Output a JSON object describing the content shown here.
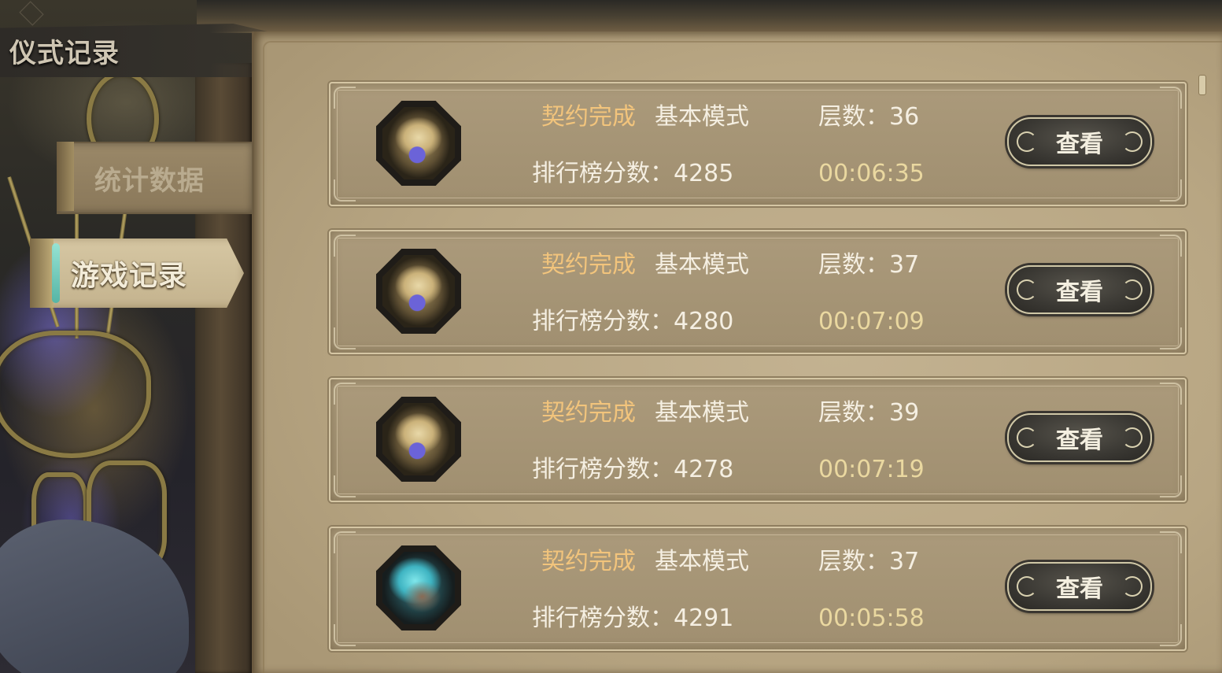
{
  "header": {
    "title": "仪式记录"
  },
  "sidebar": {
    "tabs": [
      {
        "label": "统计数据",
        "active": false
      },
      {
        "label": "游戏记录",
        "active": true
      }
    ]
  },
  "records": [
    {
      "avatar": "blonde-hero-portrait",
      "status": "契约完成",
      "mode": "基本模式",
      "floor": "层数：36",
      "score": "排行榜分数：4285",
      "time": "00:06:35",
      "button": "查看"
    },
    {
      "avatar": "blonde-hero-portrait",
      "status": "契约完成",
      "mode": "基本模式",
      "floor": "层数：37",
      "score": "排行榜分数：4280",
      "time": "00:07:09",
      "button": "查看"
    },
    {
      "avatar": "blonde-hero-portrait",
      "status": "契约完成",
      "mode": "基本模式",
      "floor": "层数：39",
      "score": "排行榜分数：4278",
      "time": "00:07:19",
      "button": "查看"
    },
    {
      "avatar": "teal-hair-hero-portrait",
      "status": "契约完成",
      "mode": "基本模式",
      "floor": "层数：37",
      "score": "排行榜分数：4291",
      "time": "00:05:58",
      "button": "查看"
    }
  ],
  "colors": {
    "status_accent": "#f2c47c",
    "time_accent": "#ead8a0",
    "parchment": "#b8a683"
  }
}
